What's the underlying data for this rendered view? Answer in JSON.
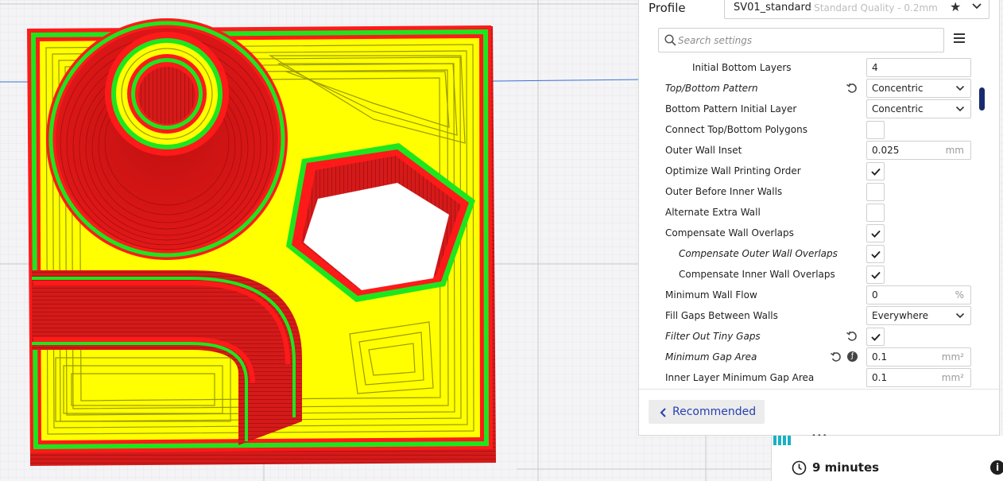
{
  "profile": {
    "label": "Profile",
    "name": "SV01_standard",
    "description": "- Standard Quality - 0.2mm"
  },
  "search": {
    "placeholder": "Search settings"
  },
  "settings": [
    {
      "label": "Initial Bottom Layers",
      "control": "text",
      "value": "4",
      "unit": ""
    },
    {
      "label": "Top/Bottom Pattern",
      "control": "select",
      "value": "Concentric",
      "italic": true,
      "reset": true
    },
    {
      "label": "Bottom Pattern Initial Layer",
      "control": "select",
      "value": "Concentric"
    },
    {
      "label": "Connect Top/Bottom Polygons",
      "control": "checkbox",
      "checked": false
    },
    {
      "label": "Outer Wall Inset",
      "control": "text",
      "value": "0.025",
      "unit": "mm"
    },
    {
      "label": "Optimize Wall Printing Order",
      "control": "checkbox",
      "checked": true
    },
    {
      "label": "Outer Before Inner Walls",
      "control": "checkbox",
      "checked": false
    },
    {
      "label": "Alternate Extra Wall",
      "control": "checkbox",
      "checked": false
    },
    {
      "label": "Compensate Wall Overlaps",
      "control": "checkbox",
      "checked": true
    },
    {
      "label": "Compensate Outer Wall Overlaps",
      "control": "checkbox",
      "checked": true,
      "italic": true
    },
    {
      "label": "Compensate Inner Wall Overlaps",
      "control": "checkbox",
      "checked": true
    },
    {
      "label": "Minimum Wall Flow",
      "control": "text",
      "value": "0",
      "unit": "%"
    },
    {
      "label": "Fill Gaps Between Walls",
      "control": "select",
      "value": "Everywhere"
    },
    {
      "label": "Filter Out Tiny Gaps",
      "control": "checkbox",
      "checked": true,
      "italic": true,
      "reset": true
    },
    {
      "label": "Minimum Gap Area",
      "control": "text",
      "value": "0.1",
      "unit": "mm²",
      "italic": true,
      "reset": true,
      "info": true
    },
    {
      "label": "Inner Layer Minimum Gap Area",
      "control": "text",
      "value": "0.1",
      "unit": "mm²"
    }
  ],
  "footer": {
    "recommended_label": "Recommended"
  },
  "print_info": {
    "time": "9 minutes",
    "info_glyph": "i"
  },
  "colors": {
    "wall_outer": "#ff1a1a",
    "wall_inner": "#1ee61e",
    "skin": "#ffff00",
    "accent": "#2540b0"
  }
}
